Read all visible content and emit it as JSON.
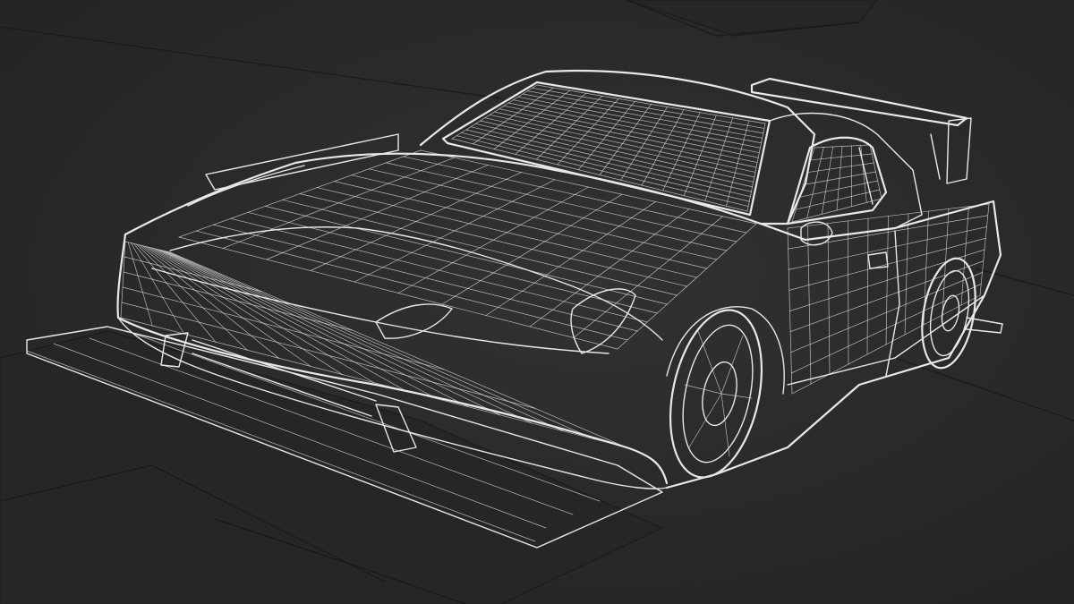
{
  "viewport": {
    "background": "#2a2a2b",
    "wire_color": "#e8e8e8",
    "subject": "car-wireframe"
  }
}
